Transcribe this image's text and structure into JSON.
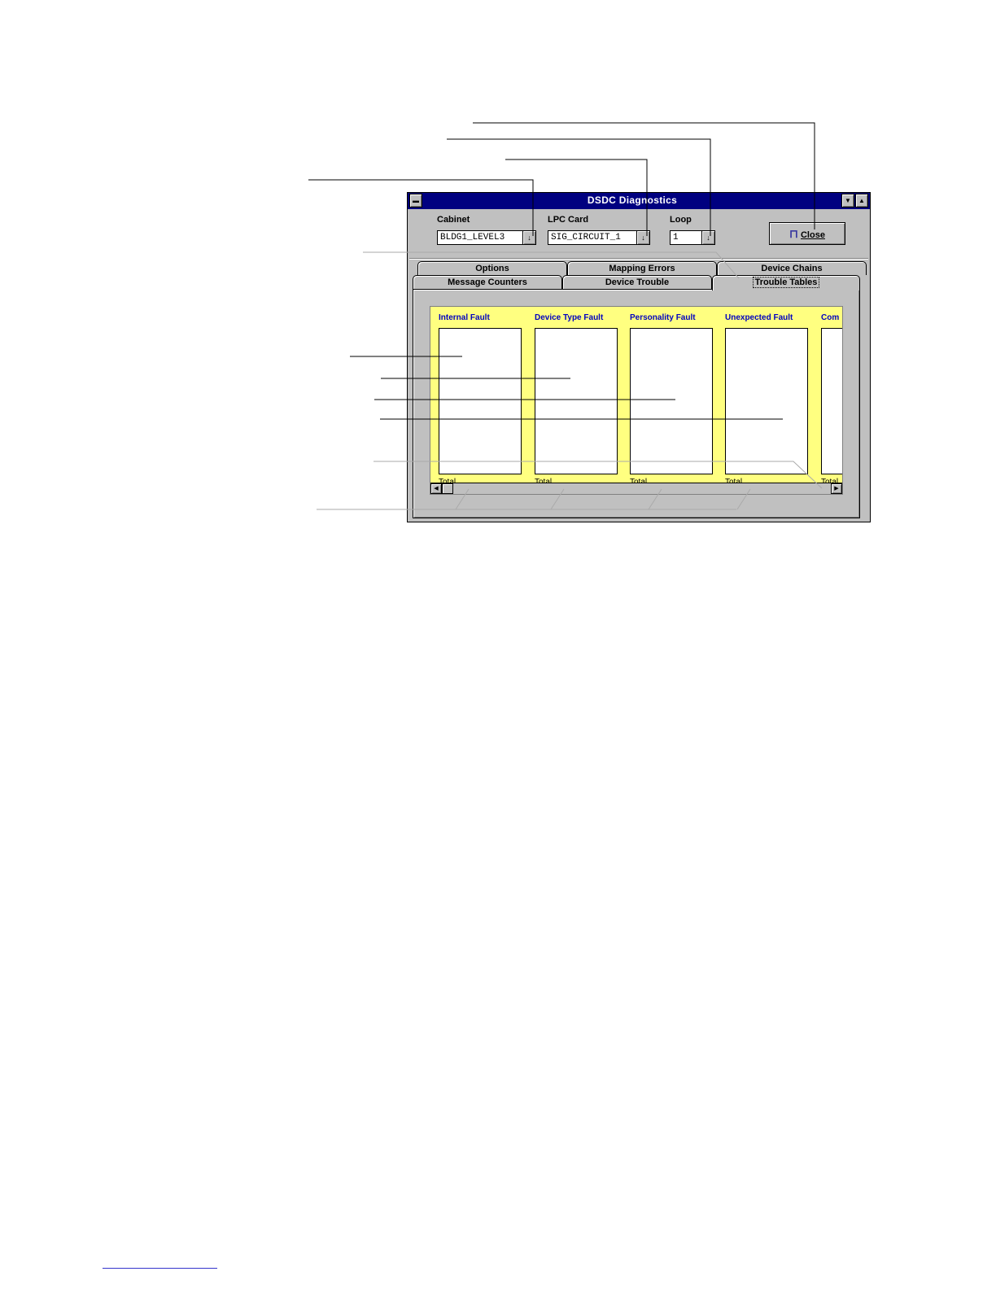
{
  "window": {
    "title": "DSDC Diagnostics",
    "sysmenu_icon": "minus-icon",
    "minimize_icon": "down-arrow-icon",
    "maximize_icon": "up-arrow-icon"
  },
  "selectors": {
    "cabinet": {
      "label": "Cabinet",
      "value": "BLDG1_LEVEL3"
    },
    "lpc_card": {
      "label": "LPC Card",
      "value": "SIG_CIRCUIT_1"
    },
    "loop": {
      "label": "Loop",
      "value": "1"
    },
    "dropdown_icon": "↓"
  },
  "close_button": {
    "label": "Close",
    "icon": "door-icon"
  },
  "tabs": {
    "back_row": [
      "Options",
      "Mapping Errors",
      "Device Chains"
    ],
    "front_row": [
      "Message Counters",
      "Device Trouble",
      "Trouble Tables"
    ],
    "active": "Trouble Tables"
  },
  "trouble_tables": {
    "columns": [
      {
        "header": "Internal Fault",
        "total": "Total"
      },
      {
        "header": "Device Type Fault",
        "total": "Total"
      },
      {
        "header": "Personality Fault",
        "total": "Total"
      },
      {
        "header": "Unexpected Fault",
        "total": "Total"
      },
      {
        "header": "Com",
        "total": "Total"
      }
    ]
  },
  "colors": {
    "titlebar": "#000080",
    "panel": "#c0c0c0",
    "table_background": "#ffff80",
    "column_header": "#0000c0",
    "footer_rule": "#3333cc"
  }
}
